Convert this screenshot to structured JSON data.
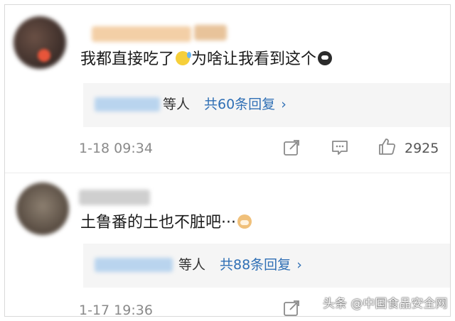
{
  "comments": [
    {
      "text": "我都直接吃了",
      "text_after": "为啥让我看到这个",
      "emojis": [
        "sweat-smile-emoji",
        "shocked-face-emoji"
      ],
      "replies": {
        "suffix": "等人",
        "count_label": "共60条回复"
      },
      "timestamp": "1-18 09:34",
      "likes": "2925"
    },
    {
      "text": "土鲁番的土也不脏吧···",
      "emojis": [
        "doge-emoji"
      ],
      "replies": {
        "suffix": "等人",
        "count_label": "共88条回复"
      },
      "timestamp": "1-17 19:36"
    }
  ],
  "chevron": "›",
  "watermark": "头条 @中国食品安全网",
  "colors": {
    "link": "#2f6fb5",
    "meta": "#8a8a8a",
    "reply_bg": "#f5f5f5"
  }
}
